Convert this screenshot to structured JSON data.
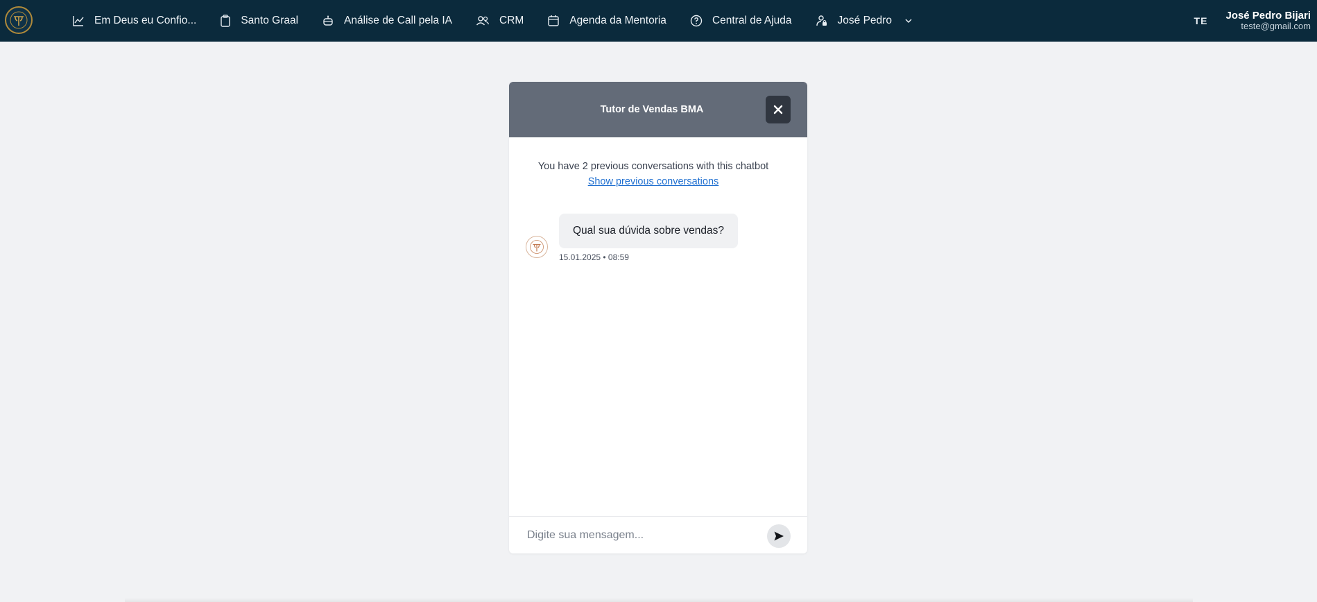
{
  "nav": {
    "items": [
      {
        "label": "Em Deus eu Confio...",
        "icon": "trending-up-icon"
      },
      {
        "label": "Santo Graal",
        "icon": "clipboard-icon"
      },
      {
        "label": "Análise de Call pela IA",
        "icon": "robot-icon"
      },
      {
        "label": "CRM",
        "icon": "users-icon"
      },
      {
        "label": "Agenda da Mentoria",
        "icon": "calendar-icon"
      },
      {
        "label": "Central de Ajuda",
        "icon": "help-circle-icon"
      },
      {
        "label": "José Pedro",
        "icon": "user-lock-icon"
      }
    ]
  },
  "user": {
    "initials": "TE",
    "name": "José Pedro Bijari",
    "email": "teste@gmail.com"
  },
  "chat": {
    "title": "Tutor de Vendas BMA",
    "previous_info": "You have 2 previous conversations with this chatbot",
    "previous_link": "Show previous conversations",
    "messages": [
      {
        "text": "Qual sua dúvida sobre vendas?",
        "time": "15.01.2025 • 08:59"
      }
    ],
    "input_placeholder": "Digite sua mensagem..."
  },
  "colors": {
    "topbar": "#0b2a3c",
    "chat_header": "#636b78",
    "link": "#1f6fd0",
    "page_bg": "#f1f2f4"
  }
}
